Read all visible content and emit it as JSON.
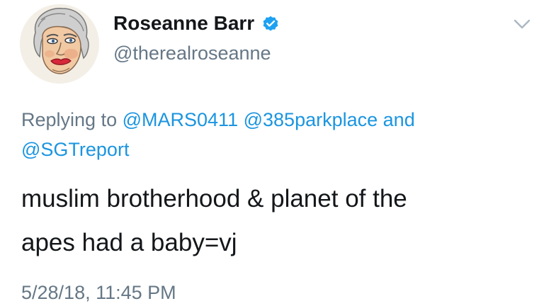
{
  "author": {
    "display_name": "Roseanne Barr",
    "handle": "@therealroseanne",
    "verified": true
  },
  "reply_context": {
    "prefix": "Replying to",
    "mention_1": "@MARS0411",
    "mention_2": "@385parkplace",
    "conjunction": "and",
    "mention_3": "@SGTreport"
  },
  "tweet": {
    "line_1": "muslim brotherhood & planet of the",
    "line_2": "apes had a baby=vj"
  },
  "timestamp": "5/28/18, 11:45 PM",
  "icons": {
    "avatar": "avatar-illustration",
    "verified": "verified-badge-icon",
    "menu": "chevron-down-icon"
  },
  "colors": {
    "text": "#14171a",
    "secondary": "#657786",
    "link": "#1b95e0",
    "verified": "#1da1f2"
  }
}
